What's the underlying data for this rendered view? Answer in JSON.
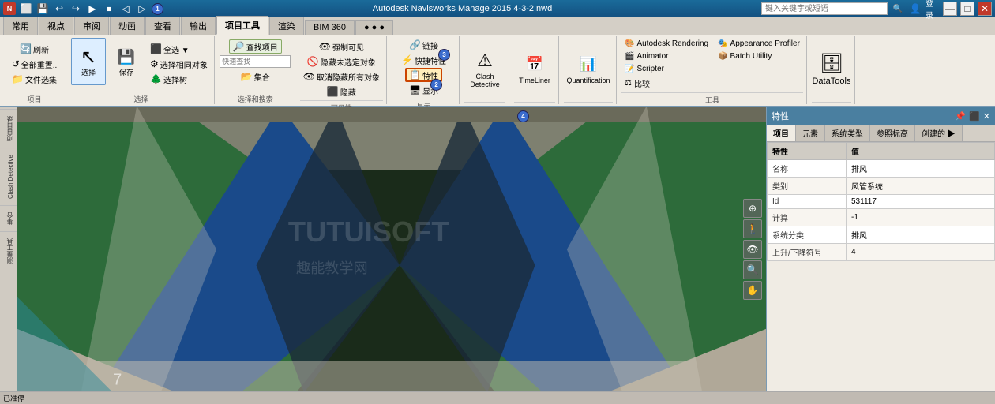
{
  "app": {
    "title": "Autodesk Navisworks Manage 2015  4-3-2.nwd",
    "search_placeholder": "键入关键字或短语"
  },
  "quick_access": {
    "buttons": [
      "⬜",
      "💾",
      "↩",
      "↪",
      "▶",
      "⬛",
      "◁",
      "▷",
      "▫"
    ]
  },
  "ribbon": {
    "tabs": [
      "常用",
      "视点",
      "审阅",
      "动画",
      "查看",
      "输出",
      "项目工具",
      "渲染",
      "BIM 360",
      "●●●"
    ],
    "active_tab": "项目工具",
    "sections": {
      "project": {
        "label": "项目",
        "buttons": [
          "刷新",
          "全部重置..",
          "文件选集"
        ]
      },
      "select": {
        "label": "选择",
        "large_btn": "选择",
        "save_btn": "保存",
        "btns": [
          "全选 ▼",
          "选择相同对象",
          "选择树"
        ]
      },
      "search": {
        "label": "选择和搜索",
        "btns": [
          "查找项目",
          "快速查找",
          "集合"
        ]
      },
      "visibility": {
        "label": "可见性",
        "btns": [
          "强制可见",
          "隐藏未选定对象",
          "取消隐藏所有对象",
          "隐藏"
        ]
      },
      "properties": {
        "label": "显示",
        "btns": [
          "链接",
          "快捷特性",
          "特性",
          "显示"
        ]
      },
      "clash": {
        "label": "",
        "btn": "Clash Detective"
      },
      "timeliner": {
        "label": "",
        "btn": "TimeLiner"
      },
      "quantification": {
        "label": "",
        "btn": "Quantification"
      },
      "tools": {
        "label": "工具",
        "items": [
          {
            "label": "Autodesk Rendering",
            "icon": "🎨"
          },
          {
            "label": "Animator",
            "icon": "🎬"
          },
          {
            "label": "Scripter",
            "icon": "📝"
          },
          {
            "label": "比较",
            "icon": "⚖"
          },
          {
            "label": "Appearance Profiler",
            "icon": "🎭"
          },
          {
            "label": "Batch Utility",
            "icon": "📦"
          }
        ]
      },
      "datatool": {
        "label": "",
        "btn": "DataTools",
        "icon": "🗄"
      }
    }
  },
  "left_sidebar": {
    "tabs": [
      "项目目录",
      "Clash Detective",
      "集合",
      "测量工具"
    ]
  },
  "properties_panel": {
    "title": "特性",
    "close": "✕",
    "tabs": [
      "项目",
      "元素",
      "系统类型",
      "参照标高",
      "创建的▶"
    ],
    "active_tab": "项目",
    "col_headers": [
      "特性",
      "值"
    ],
    "rows": [
      {
        "prop": "名称",
        "value": "排风"
      },
      {
        "prop": "类别",
        "value": "风管系统"
      },
      {
        "prop": "Id",
        "value": "531117"
      },
      {
        "prop": "计算",
        "value": "-1"
      },
      {
        "prop": "系统分类",
        "value": "排风"
      },
      {
        "prop": "上升/下降符号",
        "value": "4"
      }
    ]
  },
  "status_bar": {
    "text": "已准停"
  },
  "watermark": {
    "text": "TUTUISOFT\n趣能教学网"
  },
  "badges": {
    "1": "1",
    "2": "2",
    "3": "3",
    "4": "4"
  }
}
